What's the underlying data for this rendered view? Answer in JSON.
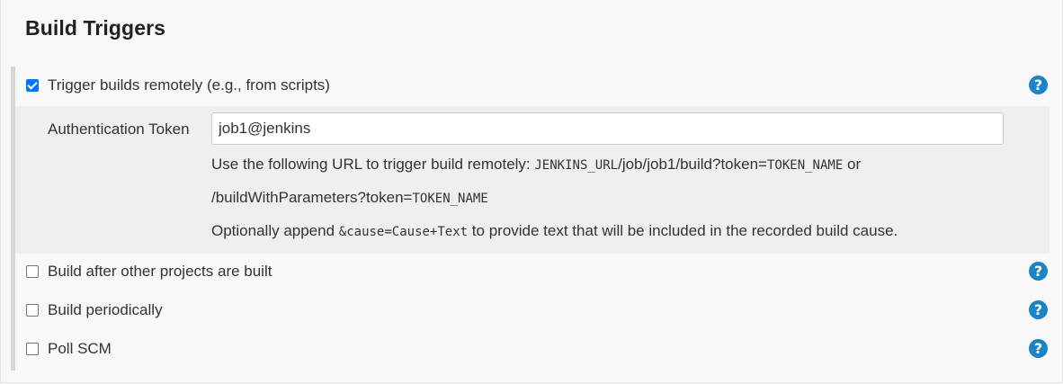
{
  "section": {
    "title": "Build Triggers"
  },
  "triggers": [
    {
      "label": "Trigger builds remotely (e.g., from scripts)",
      "checked": true,
      "help": "?"
    },
    {
      "label": "Build after other projects are built",
      "checked": false,
      "help": "?"
    },
    {
      "label": "Build periodically",
      "checked": false,
      "help": "?"
    },
    {
      "label": "Poll SCM",
      "checked": false,
      "help": "?"
    }
  ],
  "remote": {
    "auth_label": "Authentication Token",
    "token_value": "job1@jenkins",
    "line1_prefix": "Use the following URL to trigger build remotely: ",
    "line1_code1": "JENKINS_URL",
    "line1_mid": "/job/job1/build?token=",
    "line1_code2": "TOKEN_NAME",
    "line1_suffix": " or",
    "line2_text": "/buildWithParameters?token=",
    "line2_code": "TOKEN_NAME",
    "line3_prefix": "Optionally append ",
    "line3_code": "&cause=Cause+Text",
    "line3_suffix": " to provide text that will be included in the recorded build cause."
  },
  "colors": {
    "checkbox_checked": "#0075ff",
    "help_icon": "#1b84c6",
    "sub_block_bg": "#efefef",
    "page_bg": "#f8f8f8"
  }
}
